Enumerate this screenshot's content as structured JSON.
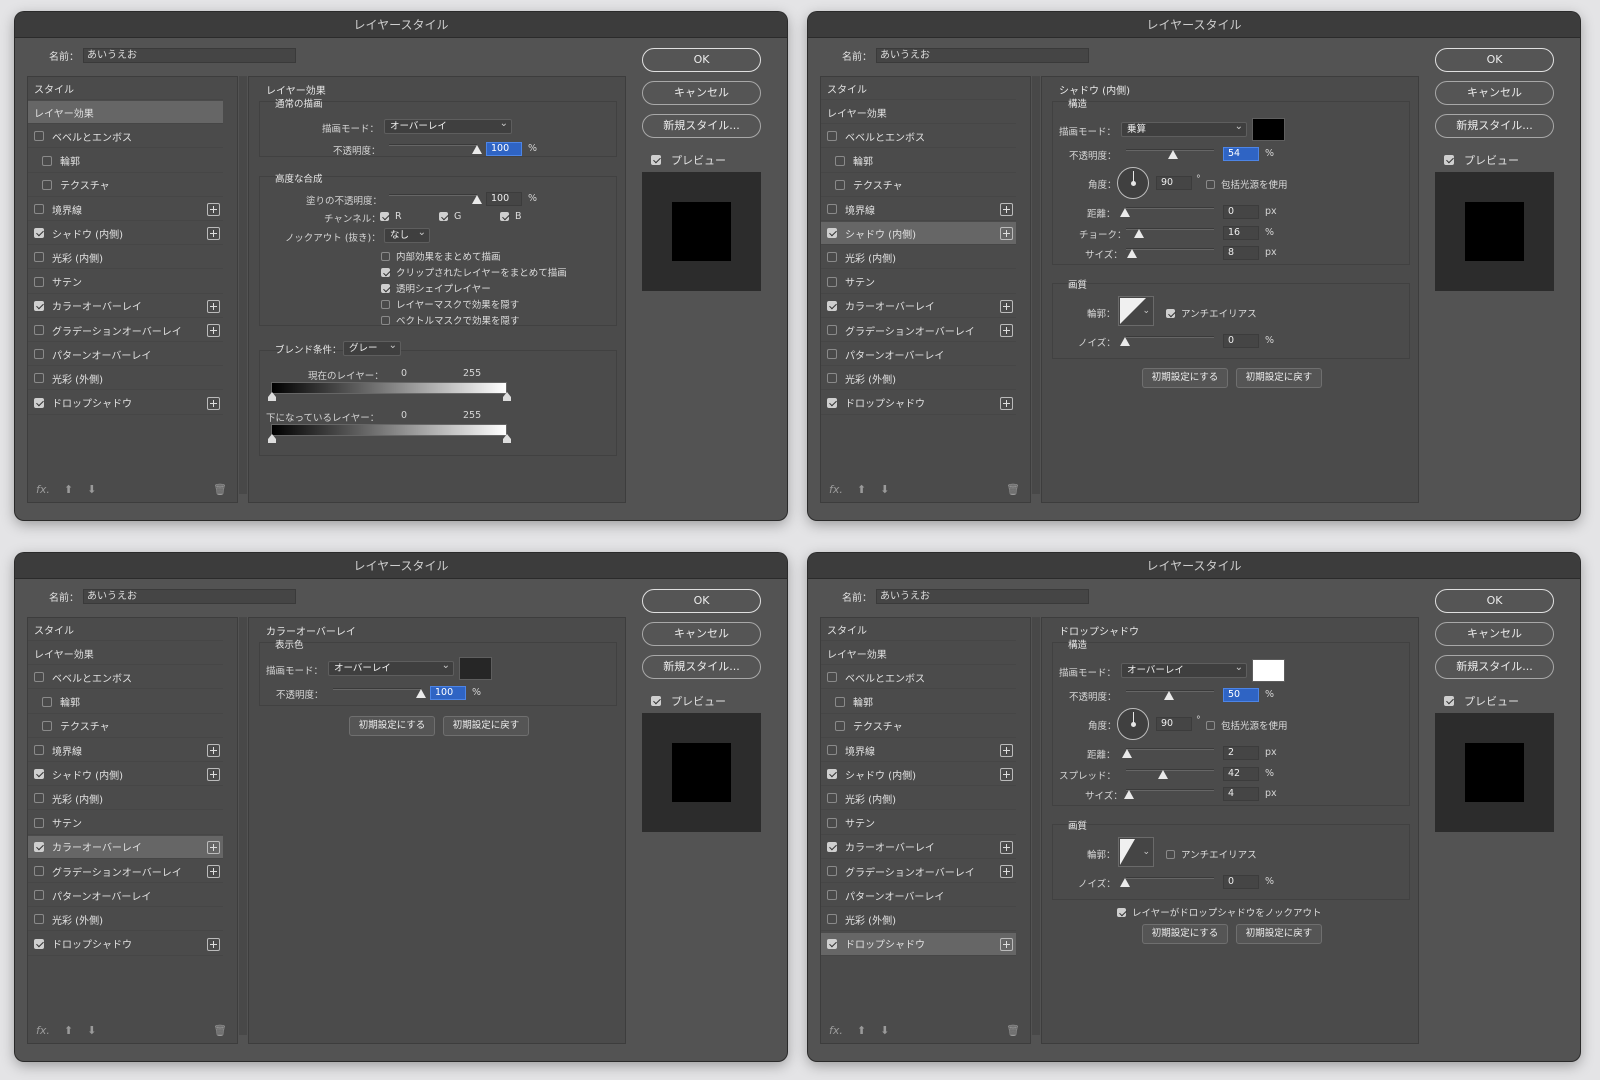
{
  "common": {
    "title": "レイヤースタイル",
    "name_label": "名前：",
    "name_value": "あいうえお",
    "ok": "OK",
    "cancel": "キャンセル",
    "new_style": "新規スタイル...",
    "preview": "プレビュー",
    "styles_items": [
      "スタイル",
      "レイヤー効果",
      "ベベルとエンボス",
      "輪郭",
      "テクスチャ",
      "境界線",
      "シャドウ (内側)",
      "光彩 (内側)",
      "サテン",
      "カラーオーバーレイ",
      "グラデーションオーバーレイ",
      "パターンオーバーレイ",
      "光彩 (外側)",
      "ドロップシャドウ"
    ],
    "fx": "fx.",
    "reset_default": "初期設定にする",
    "restore_default": "初期設定に戻す",
    "blend_mode_label": "描画モード：",
    "opacity_label": "不透明度：",
    "angle_label": "角度：",
    "global_light": "包括光源を使用",
    "distance_label": "距離：",
    "size_label": "サイズ：",
    "quality": "画質",
    "contour_label": "輪郭：",
    "antialias": "アンチエイリアス",
    "noise_label": "ノイズ：",
    "structure": "構造",
    "px": "px",
    "pct": "%",
    "deg": "°"
  },
  "d1": {
    "section_title": "レイヤー効果",
    "general_blending": "通常の描画",
    "blend_mode": "オーバーレイ",
    "opacity": "100",
    "advanced_blending": "高度な合成",
    "fill_opacity_label": "塗りの不透明度：",
    "fill_opacity": "100",
    "channels_label": "チャンネル：",
    "ch_r": "R",
    "ch_g": "G",
    "ch_b": "B",
    "knockout_label": "ノックアウト (抜き)：",
    "knockout_value": "なし",
    "options": [
      "内部効果をまとめて描画",
      "クリップされたレイヤーをまとめて描画",
      "透明シェイプレイヤー",
      "レイヤーマスクで効果を隠す",
      "ベクトルマスクで効果を隠す"
    ],
    "options_checked": [
      false,
      true,
      true,
      false,
      false
    ],
    "blend_if_label": "ブレンド条件：",
    "blend_if_value": "グレー",
    "this_layer": "現在のレイヤー：",
    "underlying_layer": "下になっているレイヤー：",
    "zero": "0",
    "max": "255",
    "selected_index": 1
  },
  "d2": {
    "section_title": "シャドウ (内側)",
    "blend_mode": "乗算",
    "swatch_color": "#000000",
    "opacity": "54",
    "angle": "90",
    "distance": "0",
    "choke_label": "チョーク：",
    "choke": "16",
    "size": "8",
    "noise": "0",
    "antialias_checked": true,
    "selected_index": 6
  },
  "d3": {
    "section_title": "カラーオーバーレイ",
    "color_label": "表示色",
    "blend_mode": "オーバーレイ",
    "swatch_color": "#262626",
    "opacity": "100",
    "selected_index": 9
  },
  "d4": {
    "section_title": "ドロップシャドウ",
    "blend_mode": "オーバーレイ",
    "swatch_color": "#ffffff",
    "opacity": "50",
    "angle": "90",
    "distance": "2",
    "spread_label": "スプレッド：",
    "spread": "42",
    "size": "4",
    "noise": "0",
    "antialias_checked": false,
    "knockout_text": "レイヤーがドロップシャドウをノックアウト",
    "selected_index": 13
  },
  "checked_states": [
    false,
    false,
    false,
    false,
    false,
    false,
    true,
    false,
    false,
    true,
    false,
    false,
    false,
    true
  ],
  "plus_rows": [
    5,
    6,
    9,
    10,
    13
  ]
}
